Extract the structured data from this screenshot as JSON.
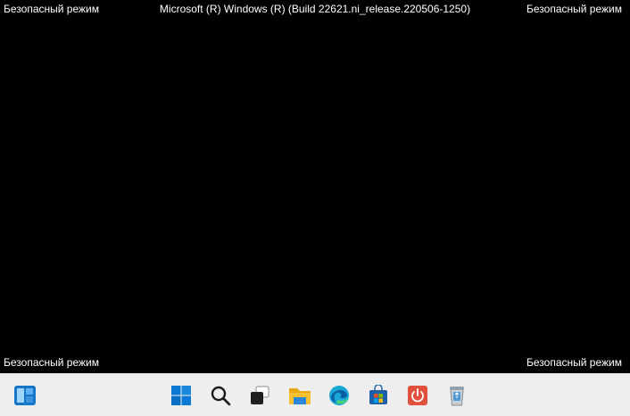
{
  "desktop": {
    "safe_mode_label": "Безопасный режим",
    "build_string": "Microsoft (R) Windows (R) (Build 22621.ni_release.220506-1250)",
    "corner_labels": {
      "top_left": "Безопасный режим",
      "top_right": "Безопасный режим",
      "bottom_left": "Безопасный режим",
      "bottom_right": "Безопасный режим"
    },
    "background_color": "#000000",
    "text_color": "#ffffff"
  },
  "taskbar": {
    "background_color": "#eeeeee",
    "items": [
      {
        "id": "widgets",
        "icon": "widgets-icon"
      },
      {
        "id": "start",
        "icon": "windows-start-icon"
      },
      {
        "id": "search",
        "icon": "search-icon"
      },
      {
        "id": "task-view",
        "icon": "task-view-icon"
      },
      {
        "id": "file-explorer",
        "icon": "folder-icon"
      },
      {
        "id": "edge",
        "icon": "edge-browser-icon"
      },
      {
        "id": "store",
        "icon": "microsoft-store-icon"
      },
      {
        "id": "power-app",
        "icon": "power-icon"
      },
      {
        "id": "recycle-bin",
        "icon": "recycle-bin-icon"
      }
    ],
    "accent_colors": {
      "windows_blue": "#0a78d4",
      "folder_yellow": "#f5c033",
      "edge_teal": "#1ba8d4",
      "power_red": "#e0503c"
    }
  }
}
